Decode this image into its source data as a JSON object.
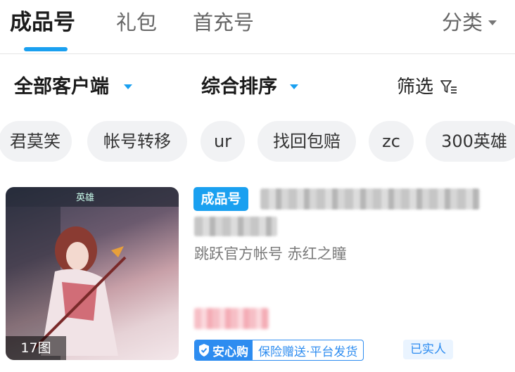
{
  "tabs": [
    {
      "label": "成品号",
      "active": true
    },
    {
      "label": "礼包",
      "active": false
    },
    {
      "label": "首充号",
      "active": false
    }
  ],
  "category": {
    "label": "分类",
    "icon": "caret-down-icon"
  },
  "filters": {
    "client": "全部客户端",
    "sort": "综合排序",
    "screen": "筛选",
    "screen_icon": "filter-icon"
  },
  "chips": [
    "君莫笑",
    "帐号转移",
    "ur",
    "找回包赔",
    "zc",
    "300英雄"
  ],
  "card": {
    "thumbnail_topbar": "英雄",
    "image_count": "17图",
    "tag": "成品号",
    "meta": "跳跃官方帐号  赤红之瞳",
    "safe_label": "安心购",
    "safe_detail": "保险赠送·平台发货",
    "verified": "已实人"
  },
  "colors": {
    "accent": "#1aa0f0",
    "safe_blue": "#2d8cf0",
    "chip_bg": "#f1f2f4"
  }
}
